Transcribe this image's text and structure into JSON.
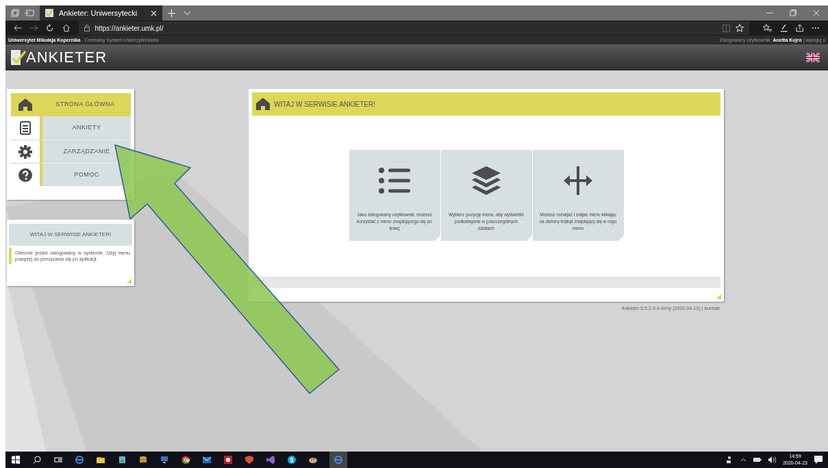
{
  "browser": {
    "tabs": [
      {
        "title": "Ankieter: Uniwersytecki",
        "selected": true
      }
    ],
    "url": "https://ankieter.umk.pl/"
  },
  "site_bar": {
    "left": "**Uniwersytet Mikołaja Kopernika** - Centralny System Uwierzytelniania",
    "right": "Zalogowany użytkownik: **Anetta Kojro** | wyloguj s"
  },
  "header": {
    "logo": "ANKIETER"
  },
  "menu": [
    {
      "kind": "home",
      "label": "STRONA GŁÓWNA",
      "selected": true
    },
    {
      "kind": "list",
      "label": "ANKIETY",
      "selected": false
    },
    {
      "kind": "gear",
      "label": "ZARZĄDZANIE",
      "selected": false
    },
    {
      "kind": "help",
      "label": "POMOC",
      "selected": false
    }
  ],
  "info_card": {
    "title": "WITAJ W SERWISIE ANKIETER!",
    "text": "Obecnie jesteś zalogowany w systemie. Użyj menu powyżej do poruszania się po aplikacji."
  },
  "main": {
    "title": "WITAJ W SERWISIE ANKIETER!",
    "tiles": [
      {
        "kind": "list",
        "text": "Jako zalogowany użytkownik, możesz korzystać z menu znajdującego się po lewej"
      },
      {
        "kind": "layers",
        "text": "Wybierz pozycję menu, aby wyświetlić podkategorie w poszczególnych działach"
      },
      {
        "kind": "move",
        "text": "Możesz rozwijać i zwijać menu klikając na zielony trójkąt znajdujący się w rogu menu"
      }
    ]
  },
  "footer": "Ankieter 6.5.2.0-4-firmy (2020-04-10) | kontakt",
  "taskbar": {
    "time": "14:59",
    "date": "2020-04-23"
  }
}
